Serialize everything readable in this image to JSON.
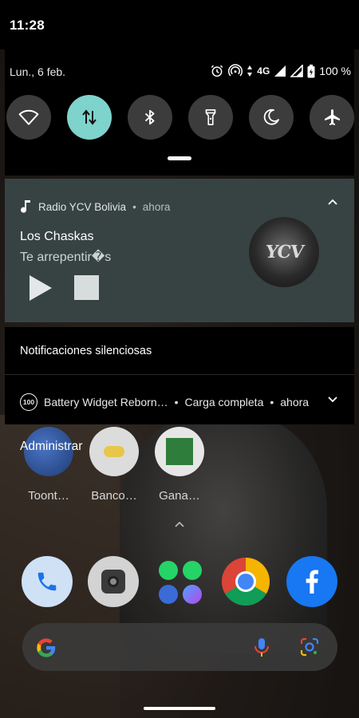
{
  "status_bar": {
    "time": "11:28"
  },
  "quick_settings": {
    "date": "Lun., 6 feb.",
    "network": "4G",
    "battery": "100 %",
    "tiles": [
      {
        "name": "wifi",
        "active": false
      },
      {
        "name": "mobile-data",
        "active": true
      },
      {
        "name": "bluetooth",
        "active": false
      },
      {
        "name": "flashlight",
        "active": false
      },
      {
        "name": "do-not-disturb",
        "active": false
      },
      {
        "name": "airplane-mode",
        "active": false
      }
    ]
  },
  "media_notification": {
    "app": "Radio YCV Bolivia",
    "time": "ahora",
    "artist": "Los Chaskas",
    "song": "Te arrepentir�s",
    "art_text": "YCV"
  },
  "silent_section": {
    "title": "Notificaciones silenciosas",
    "icon_text": "100",
    "app": "Battery Widget Reborn…",
    "message": "Carga completa",
    "time": "ahora"
  },
  "home": {
    "manage_label": "Administrar",
    "apps": [
      {
        "label": "Toont…"
      },
      {
        "label": "Banco…"
      },
      {
        "label": "Gana…"
      }
    ],
    "dock": [
      "phone-icon",
      "camera-icon",
      "app-folder",
      "chrome-icon",
      "facebook-icon"
    ]
  },
  "colors": {
    "accent": "#7fd3cd",
    "media_card": "#374343"
  }
}
